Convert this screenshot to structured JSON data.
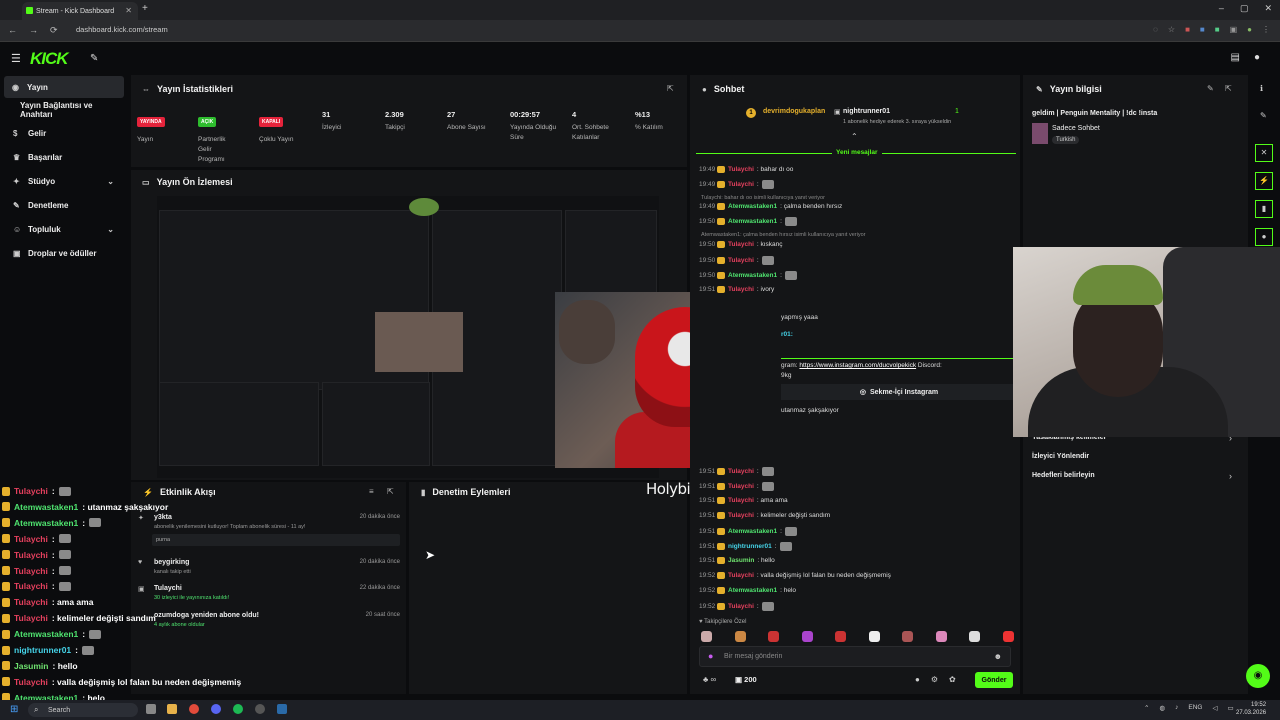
{
  "browser": {
    "tab_title": "Stream - Kick Dashboard",
    "url": "dashboard.kick.com/stream",
    "new_tab": "+",
    "nav": [
      "←",
      "→",
      "⟳"
    ],
    "window_controls": [
      "–",
      "▢",
      "✕"
    ]
  },
  "header": {
    "logo": "KICK"
  },
  "sidebar": {
    "items": [
      {
        "label": "Yayın",
        "icon": "broadcast-icon"
      },
      {
        "label": "Yayın Bağlantısı ve Anahtarı",
        "icon": ""
      },
      {
        "label": "Gelir",
        "icon": "dollar-icon"
      },
      {
        "label": "Başarılar",
        "icon": "trophy-icon"
      },
      {
        "label": "Stüdyo",
        "icon": "studio-icon"
      },
      {
        "label": "Denetleme",
        "icon": "wrench-icon"
      },
      {
        "label": "Topluluk",
        "icon": "people-icon"
      },
      {
        "label": "Droplar ve ödüller",
        "icon": "gift-icon"
      }
    ]
  },
  "stats_panel": {
    "title": "Yayın İstatistikleri",
    "stats": [
      {
        "badge": "YAYINDA",
        "badge_color": "#e5233b",
        "label": "Yayın"
      },
      {
        "badge": "AÇIK",
        "badge_color": "#2ebd2e",
        "label": "Partnerlik Gelir Programı"
      },
      {
        "badge": "KAPALI",
        "badge_color": "#e5233b",
        "label": "Çoklu Yayın"
      },
      {
        "value": "31",
        "label": "İzleyici"
      },
      {
        "value": "2.309",
        "label": "Takipçi"
      },
      {
        "value": "27",
        "label": "Abone Sayısı"
      },
      {
        "value": "00:29:57",
        "label": "Yayında Olduğu Süre"
      },
      {
        "value": "4",
        "label": "Ort. Sohbete Katılanlar"
      },
      {
        "value": "%13",
        "label": "% Katılım"
      }
    ]
  },
  "preview_panel": {
    "title": "Yayın Ön İzlemesi"
  },
  "watermark": "Holybigpoppa",
  "activity_panel": {
    "title": "Etkinlik Akışı",
    "events": [
      {
        "name": "y3kta",
        "sub": "abonelik yenilemesini kutluyor! Toplam abonelik süresi - 11 ay!",
        "note": "purna",
        "time": "20 dakika önce"
      },
      {
        "name": "beygirking",
        "sub": "kanalı takip etti",
        "time": "20 dakika önce"
      },
      {
        "name": "Tulaychi",
        "sub": "30 izleyici ile yayınınıza katıldı!",
        "time": "22 dakika önce"
      },
      {
        "name": "ozumdoga yeniden abone oldu!",
        "sub": "4 aylık abone oldular",
        "time": "20 saat önce"
      }
    ]
  },
  "moderation_panel": {
    "title": "Denetim Eylemleri"
  },
  "overlay_chat": [
    {
      "user": "Tulaychi",
      "text": ":",
      "emote": true,
      "color": "#e5405e"
    },
    {
      "user": "Atemwastaken1",
      "text": ": utanmaz şakşakıyor",
      "emote": false,
      "color": "#4fe36f"
    },
    {
      "user": "Atemwastaken1",
      "text": ":",
      "emote": true,
      "color": "#4fe36f"
    },
    {
      "user": "Tulaychi",
      "text": ":",
      "emote": true,
      "color": "#e5405e"
    },
    {
      "user": "Tulaychi",
      "text": ":",
      "emote": true,
      "color": "#e5405e"
    },
    {
      "user": "Tulaychi",
      "text": ":",
      "emote": true,
      "color": "#e5405e"
    },
    {
      "user": "Tulaychi",
      "text": ":",
      "emote": true,
      "color": "#e5405e"
    },
    {
      "user": "Tulaychi",
      "text": ": ama ama",
      "emote": false,
      "color": "#e5405e"
    },
    {
      "user": "Tulaychi",
      "text": ": kelimeler değişti sandım",
      "emote": false,
      "color": "#e5405e"
    },
    {
      "user": "Atemwastaken1",
      "text": ":",
      "emote": true,
      "color": "#4fe36f"
    },
    {
      "user": "nightrunner01",
      "text": ":",
      "emote": true,
      "color": "#45d3e8"
    },
    {
      "user": "Jasumin",
      "text": ": hello",
      "emote": false,
      "color": "#6fe36f"
    },
    {
      "user": "Tulaychi",
      "text": ": valla değişmiş lol falan bu neden değişmemiş",
      "emote": false,
      "color": "#e5405e"
    },
    {
      "user": "Atemwastaken1",
      "text": ": helo",
      "emote": false,
      "color": "#4fe36f"
    }
  ],
  "chat_panel": {
    "title": "Sohbet",
    "pinned": {
      "gifter": "devrimdogukaplan",
      "recipient": "nightrunner01",
      "count_left": "1",
      "count_right": "1",
      "note": "1 abonelik hediye ederek 3. sıraya yükseldin"
    },
    "new_messages": "Yeni mesajlar",
    "messages": [
      {
        "time": "19:49",
        "user": "Tulaychi",
        "text": ": bahar dı oo"
      },
      {
        "time": "19:49",
        "user": "Tulaychi",
        "text": ":"
      },
      {
        "reply": "Tulaychi: bahar dı oo isimli kullanıcıya yanıt veriyor"
      },
      {
        "time": "19:49",
        "user": "Atemwastaken1",
        "text": ": çalma benden hırsız"
      },
      {
        "time": "19:50",
        "user": "Atemwastaken1",
        "text": ":"
      },
      {
        "reply": "Atemwastaken1: çalma benden hırsız isimli kullanıcıya yanıt veriyor"
      },
      {
        "time": "19:50",
        "user": "Tulaychi",
        "text": ": kıskanç"
      },
      {
        "time": "19:50",
        "user": "Tulaychi",
        "text": ":"
      },
      {
        "time": "19:50",
        "user": "Atemwastaken1",
        "text": ":"
      },
      {
        "time": "19:51",
        "user": "Tulaychi",
        "text": ": ivory"
      }
    ],
    "partial_1": "yapmış yaaa",
    "partial_2": "r01:",
    "link_prefix": "gram: ",
    "link": "https://www.instagram.com/ducvolpekick",
    "link_suffix": " Discord:",
    "link_tail": "9kg",
    "insta_button": "Sekme-İçi Instagram",
    "partial_3": "utanmaz şakşakıyor",
    "messages2": [
      {
        "time": "19:51",
        "user": "Tulaychi",
        "text": ":"
      },
      {
        "time": "19:51",
        "user": "Tulaychi",
        "text": ":"
      },
      {
        "time": "19:51",
        "user": "Tulaychi",
        "text": ": ama ama"
      },
      {
        "time": "19:51",
        "user": "Tulaychi",
        "text": ": kelimeler değişti sandım"
      },
      {
        "time": "19:51",
        "user": "Atemwastaken1",
        "text": ":"
      },
      {
        "time": "19:51",
        "user": "nightrunner01",
        "text": ":"
      },
      {
        "time": "19:51",
        "user": "Jasumin",
        "text": ": hello"
      },
      {
        "time": "19:52",
        "user": "Tulaychi",
        "text": ": valla değişmiş lol falan bu neden değişmemiş"
      },
      {
        "time": "19:52",
        "user": "Atemwastaken1",
        "text": ": helo"
      },
      {
        "time": "19:52",
        "user": "Tulaychi",
        "text": ":"
      }
    ],
    "followers_label": "Takipçilere Özel",
    "input_placeholder": "Bir mesaj gönderin",
    "points": "200",
    "send": "Gönder",
    "infinity": "∞"
  },
  "info_panel": {
    "title": "Yayın bilgisi",
    "stream_title": "geldim | Penguin Mentality | !dc !insta",
    "category": "Sadece Sohbet",
    "language": "Turkish",
    "items": [
      "Yasaklanmış kelimeler",
      "İzleyici Yönlendir",
      "Hedefleri belirleyin"
    ]
  },
  "taskbar": {
    "search": "Search",
    "lang": "ENG",
    "time": "19:52",
    "date": "27.03.2026"
  },
  "colors": {
    "kick_green": "#53fc18",
    "panel_bg": "#141517",
    "page_bg": "#0b0c0e"
  }
}
